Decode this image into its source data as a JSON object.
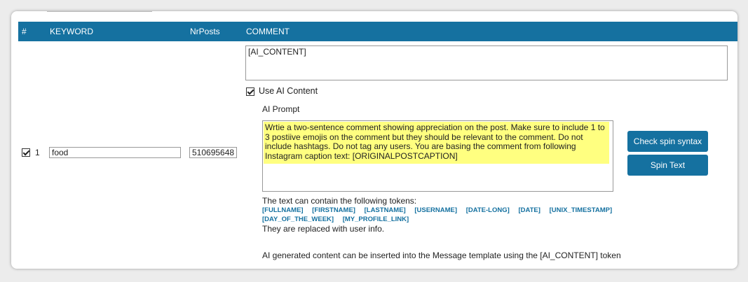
{
  "table": {
    "headers": {
      "num": "#",
      "keyword": "KEYWORD",
      "nrposts": "NrPosts",
      "comment": "COMMENT"
    },
    "row": {
      "checked": true,
      "number": "1",
      "keyword": "food",
      "nrposts": "510695648",
      "comment": "[AI_CONTENT]",
      "use_ai_label": "Use AI Content",
      "use_ai_checked": true,
      "ai_prompt_label": "AI Prompt",
      "ai_prompt": "Wrtie a two-sentence comment showing appreciation on the post. Make sure to include 1 to 3 postiive emojis on the comment but they should be relevant to the comment. Do not include hashtags. Do not tag any users. You are basing the comment from following Instagram caption text: [ORIGINALPOSTCAPTION]",
      "check_spin_label": "Check spin syntax",
      "spin_text_label": "Spin Text",
      "tokens_intro": "The text can contain the following tokens:",
      "tokens": [
        "[FULLNAME]",
        "[FIRSTNAME]",
        "[LASTNAME]",
        "[USERNAME]",
        "[DATE-LONG]",
        "[DATE]",
        "[UNIX_TIMESTAMP]",
        "[DAY_OF_THE_WEEK]",
        "[MY_PROFILE_LINK]"
      ],
      "tokens_replaced": "They are replaced with user info.",
      "ai_note": "AI generated content can be inserted into the Message template using the [AI_CONTENT] token"
    }
  },
  "colors": {
    "header_bg": "#1571a0",
    "button_bg": "#1571a0",
    "highlight": "#ffff80"
  }
}
